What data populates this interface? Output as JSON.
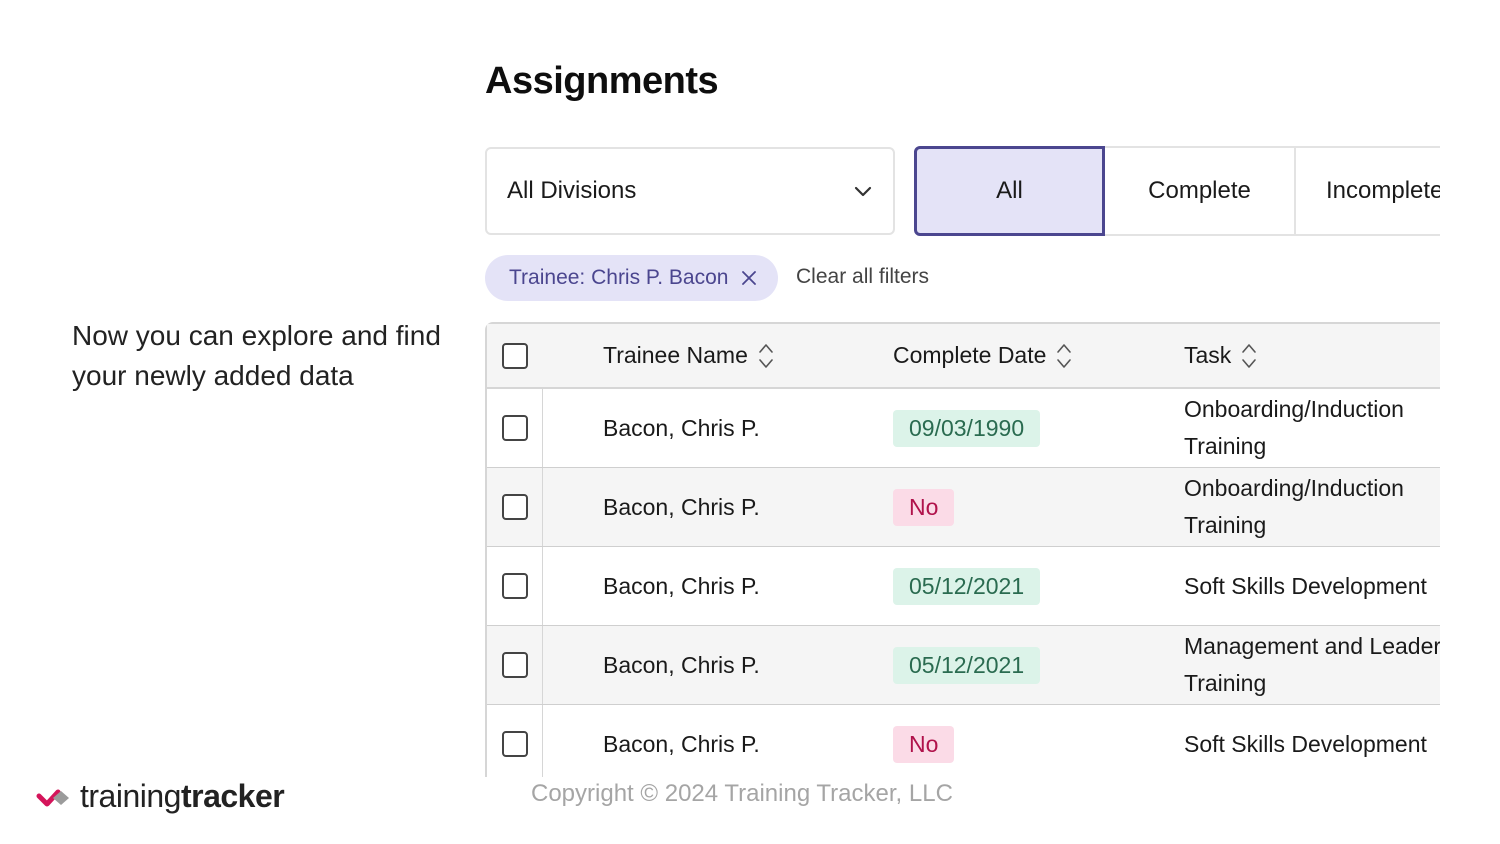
{
  "caption": "Now you can explore and find your newly added data",
  "page_title": "Assignments",
  "division_select": {
    "value": "All Divisions"
  },
  "status_tabs": [
    {
      "label": "All",
      "active": true
    },
    {
      "label": "Complete",
      "active": false
    },
    {
      "label": "Incomplete",
      "active": false
    }
  ],
  "filter_chip": "Trainee: Chris P. Bacon",
  "clear_filters": "Clear all filters",
  "table": {
    "columns": [
      "Trainee Name",
      "Complete Date",
      "Task"
    ],
    "rows": [
      {
        "name": "Bacon, Chris P.",
        "complete_date": "09/03/1990",
        "status": "complete",
        "task": "Onboarding/Induction Training"
      },
      {
        "name": "Bacon, Chris P.",
        "complete_date": "No",
        "status": "incomplete",
        "task": "Onboarding/Induction Training"
      },
      {
        "name": "Bacon, Chris P.",
        "complete_date": "05/12/2021",
        "status": "complete",
        "task": "Soft Skills Development"
      },
      {
        "name": "Bacon, Chris P.",
        "complete_date": "05/12/2021",
        "status": "complete",
        "task": "Management and Leadership Training"
      },
      {
        "name": "Bacon, Chris P.",
        "complete_date": "No",
        "status": "incomplete",
        "task": "Soft Skills Development"
      }
    ]
  },
  "logo": {
    "light": "training",
    "bold": "tracker"
  },
  "copyright": "Copyright © 2024 Training Tracker, LLC",
  "colors": {
    "accent": "#4b468f",
    "accent_bg": "#e4e3f7",
    "complete_bg": "#dcf3e9",
    "complete_text": "#2a6b50",
    "incomplete_bg": "#fbdbe7",
    "incomplete_text": "#b0124b",
    "logo_pink": "#d4145a",
    "logo_gray": "#9b9b9b"
  },
  "icons": {
    "select": "chevron-down-icon",
    "chip_remove": "close-icon",
    "sort": "sort-icon",
    "logo": "checkmark-arrow-icon"
  }
}
